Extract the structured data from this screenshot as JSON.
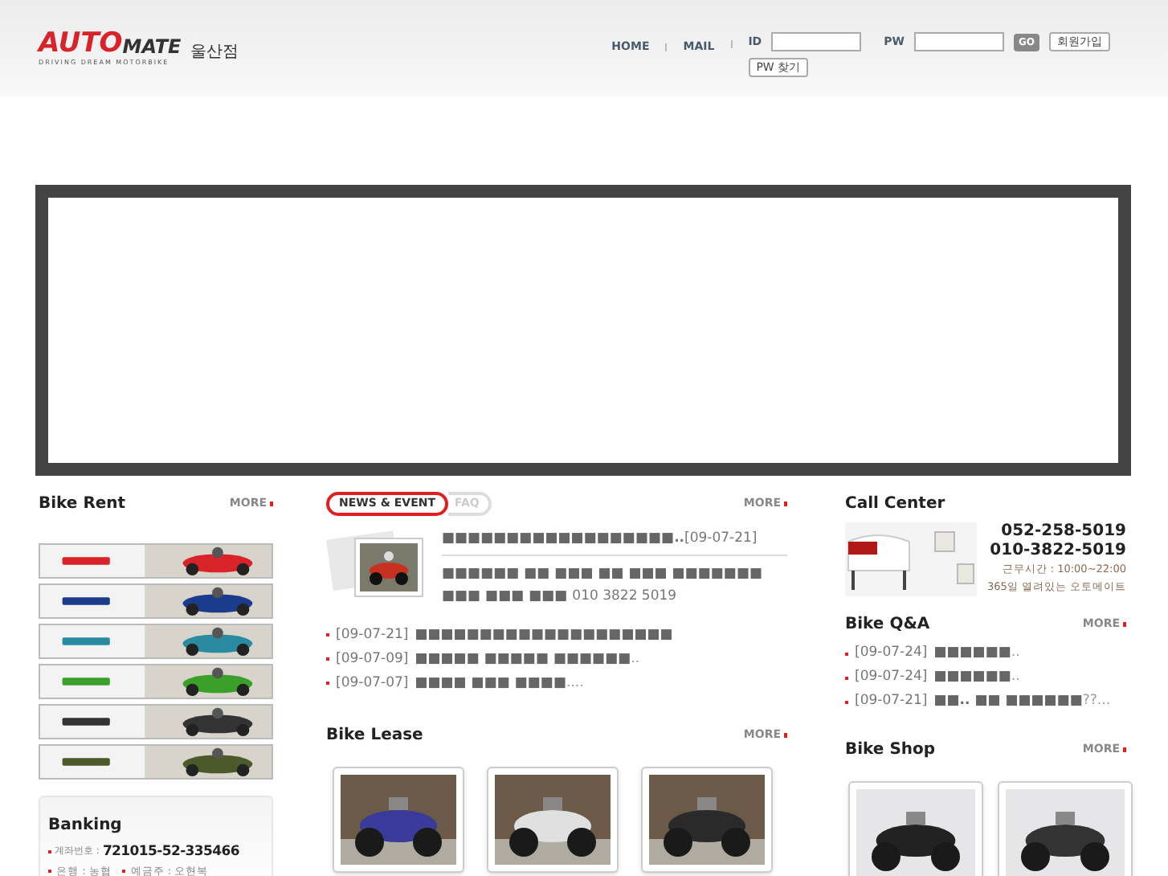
{
  "header": {
    "logo": {
      "word_1": "AUTO",
      "word_2": "MATE",
      "tagline": "DRIVING DREAM MOTORBIKE"
    },
    "branch": "울산점",
    "nav": [
      "HOME",
      "MAIL"
    ],
    "login": {
      "id_label": "ID",
      "pw_label": "PW",
      "go": "GO",
      "join": "회원가입",
      "find_pw": "PW 찾기"
    }
  },
  "bike_rent": {
    "title": "Bike Rent",
    "more": "MORE",
    "banners": [
      {
        "color": "#d8232a"
      },
      {
        "color": "#1b3c8c"
      },
      {
        "color": "#2a8aa0"
      },
      {
        "color": "#3aa02a"
      },
      {
        "color": "#333333"
      },
      {
        "color": "#4a5a2a"
      }
    ]
  },
  "banking": {
    "title": "Banking",
    "account_label": "계좌번호 :",
    "account": "721015-52-335466",
    "bank": "은행 : 농협",
    "holder": "예금주 : 오현복"
  },
  "news": {
    "tabs": [
      {
        "label": "NEWS & EVENT",
        "selected": true
      },
      {
        "label": "FAQ",
        "selected": false
      }
    ],
    "more": "MORE",
    "featured": {
      "title": "■■■■■■■■■■■■■■■■■■",
      "title_tail": "..",
      "date": "[09-07-21]",
      "body": "■■■■■■ ■■ ■■■ ■■ ■■■ ■■■■■■■ ■■■ ■■■ ■■■",
      "phone": "010 3822 5019"
    },
    "items": [
      {
        "date": "[09-07-21]",
        "title": "■■■■■■■■■■■■■■■■■■■■"
      },
      {
        "date": "[09-07-09]",
        "title": "■■■■■ ■■■■■ ■■■■■■",
        "tail": ".."
      },
      {
        "date": "[09-07-07]",
        "title": "■■■■ ■■■ ■■■■",
        "tail": "...."
      }
    ]
  },
  "call_center": {
    "title": "Call Center",
    "phone_1": "052-258-5019",
    "phone_2": "010-3822-5019",
    "hours": "근무시간 : 10:00~22:00",
    "note": "365일 열려있는 오토메이트"
  },
  "bike_qa": {
    "title": "Bike Q&A",
    "more": "MORE",
    "items": [
      {
        "date": "[09-07-24]",
        "title": "■■■■■■",
        "tail": ".."
      },
      {
        "date": "[09-07-24]",
        "title": "■■■■■■",
        "tail": ".."
      },
      {
        "date": "[09-07-21]",
        "title": "■■.. ■■ ■■■■■■",
        "tail": "??..."
      }
    ]
  },
  "bike_lease": {
    "title": "Bike Lease",
    "more": "MORE",
    "photos": [
      {
        "color": "#3a3a9a"
      },
      {
        "color": "#e0e0e0"
      },
      {
        "color": "#2a2a2a"
      }
    ]
  },
  "bike_shop": {
    "title": "Bike Shop",
    "more": "MORE",
    "photos": [
      {
        "color": "#222222"
      },
      {
        "color": "#333333"
      }
    ]
  }
}
